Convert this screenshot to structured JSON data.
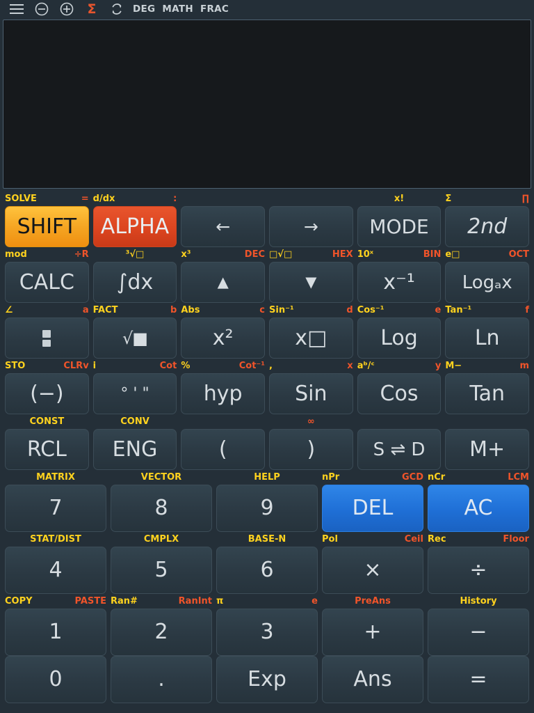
{
  "topbar": {
    "menu_icon": "hamburger-menu-icon",
    "zoom_out_icon": "minus-circle-icon",
    "zoom_in_icon": "plus-circle-icon",
    "sigma_icon": "sigma-icon",
    "refresh_icon": "refresh-icon",
    "status": [
      "DEG",
      "MATH",
      "FRAC"
    ]
  },
  "display": {
    "value": ""
  },
  "colors": {
    "shift_label": "#ffd21e",
    "alpha_label": "#f0542a",
    "shift_key_bg": "#f5a623",
    "alpha_key_bg": "#dc4520",
    "clear_key_bg": "#1f6fd6",
    "key_bg": "#2b3943",
    "display_bg": "#16191c",
    "body_bg": "#242f38"
  },
  "keypad": {
    "rows": [
      {
        "labels": [
          {
            "shift": "SOLVE",
            "alpha": "="
          },
          {
            "shift": "d/dx",
            "alpha": ":"
          },
          {},
          {},
          {
            "center_shift": "x!"
          },
          {
            "shift": "Σ",
            "alpha": "∏"
          }
        ],
        "keys": [
          {
            "label": "SHIFT",
            "style": "shift"
          },
          {
            "label": "ALPHA",
            "style": "alpha"
          },
          {
            "label": "←",
            "style": "arrow"
          },
          {
            "label": "→",
            "style": "arrow"
          },
          {
            "label": "MODE",
            "style": "med"
          },
          {
            "label": "2nd",
            "style": "italic"
          }
        ]
      },
      {
        "labels": [
          {
            "shift": "mod",
            "alpha": "÷R"
          },
          {
            "center_shift": "³√□"
          },
          {
            "shift": "x³",
            "alpha": "DEC"
          },
          {
            "shift": "□√□",
            "alpha": "HEX"
          },
          {
            "shift": "10ˣ",
            "alpha": "BIN"
          },
          {
            "shift": "e□",
            "alpha": "OCT"
          }
        ],
        "keys": [
          {
            "label": "CALC"
          },
          {
            "label": "∫dx"
          },
          {
            "label": "▲",
            "style": "tri"
          },
          {
            "label": "▼",
            "style": "tri"
          },
          {
            "label": "x⁻¹"
          },
          {
            "label": "Logₐx",
            "style": "small"
          }
        ]
      },
      {
        "labels": [
          {
            "shift": "∠",
            "alpha": "a"
          },
          {
            "shift": "FACT",
            "alpha": "b"
          },
          {
            "shift": "Abs",
            "alpha": "c"
          },
          {
            "shift": "Sin⁻¹",
            "alpha": "d"
          },
          {
            "shift": "Cos⁻¹",
            "alpha": "e"
          },
          {
            "shift": "Tan⁻¹",
            "alpha": "f"
          }
        ],
        "keys": [
          {
            "label": "",
            "style": "frac"
          },
          {
            "label": "√■",
            "style": "sqrt"
          },
          {
            "label": "x²"
          },
          {
            "label": "x□"
          },
          {
            "label": "Log"
          },
          {
            "label": "Ln"
          }
        ]
      },
      {
        "labels": [
          {
            "shift": "STO",
            "alpha": "CLRv"
          },
          {
            "shift": "i",
            "alpha": "Cot"
          },
          {
            "shift": "%",
            "alpha": "Cot⁻¹"
          },
          {
            "shift": ",",
            "alpha": "x"
          },
          {
            "shift": "aᵇ/ᶜ",
            "alpha": "y"
          },
          {
            "shift": "M−",
            "alpha": "m"
          }
        ],
        "keys": [
          {
            "label": "(−)"
          },
          {
            "label": "° ' \"",
            "style": "dms"
          },
          {
            "label": "hyp"
          },
          {
            "label": "Sin"
          },
          {
            "label": "Cos"
          },
          {
            "label": "Tan"
          }
        ]
      },
      {
        "labels": [
          {
            "center_shift": "CONST"
          },
          {
            "center_shift": "CONV"
          },
          {},
          {
            "center_alpha": "∞"
          },
          {},
          {}
        ],
        "keys": [
          {
            "label": "RCL"
          },
          {
            "label": "ENG"
          },
          {
            "label": "("
          },
          {
            "label": ")"
          },
          {
            "label": "S ⇌ D",
            "style": "small"
          },
          {
            "label": "M+"
          }
        ]
      },
      {
        "labels": [
          {
            "center_shift": "MATRIX"
          },
          {
            "center_shift": "VECTOR"
          },
          {
            "center_shift": "HELP"
          },
          {
            "shift": "nPr",
            "alpha": "GCD"
          },
          {
            "shift": "nCr",
            "alpha": "LCM"
          }
        ],
        "keys": [
          {
            "label": "7"
          },
          {
            "label": "8"
          },
          {
            "label": "9"
          },
          {
            "label": "DEL",
            "style": "blue"
          },
          {
            "label": "AC",
            "style": "blue"
          }
        ]
      },
      {
        "labels": [
          {
            "center_shift": "STAT/DIST"
          },
          {
            "center_shift": "CMPLX"
          },
          {
            "center_shift": "BASE-N"
          },
          {
            "shift": "Pol",
            "alpha": "Ceil"
          },
          {
            "shift": "Rec",
            "alpha": "Floor"
          }
        ],
        "keys": [
          {
            "label": "4"
          },
          {
            "label": "5"
          },
          {
            "label": "6"
          },
          {
            "label": "×"
          },
          {
            "label": "÷"
          }
        ]
      },
      {
        "labels": [
          {
            "shift": "COPY",
            "alpha": "PASTE"
          },
          {
            "shift": "Ran#",
            "alpha": "RanInt"
          },
          {
            "shift": "π",
            "alpha": "e"
          },
          {
            "center_alpha": "PreAns"
          },
          {
            "center_shift": "History"
          }
        ],
        "keys": [
          {
            "label": "1"
          },
          {
            "label": "2"
          },
          {
            "label": "3"
          },
          {
            "label": "+"
          },
          {
            "label": "−"
          }
        ]
      },
      {
        "labels": [],
        "keys": [
          {
            "label": "0"
          },
          {
            "label": "."
          },
          {
            "label": "Exp"
          },
          {
            "label": "Ans"
          },
          {
            "label": "="
          }
        ]
      }
    ]
  }
}
